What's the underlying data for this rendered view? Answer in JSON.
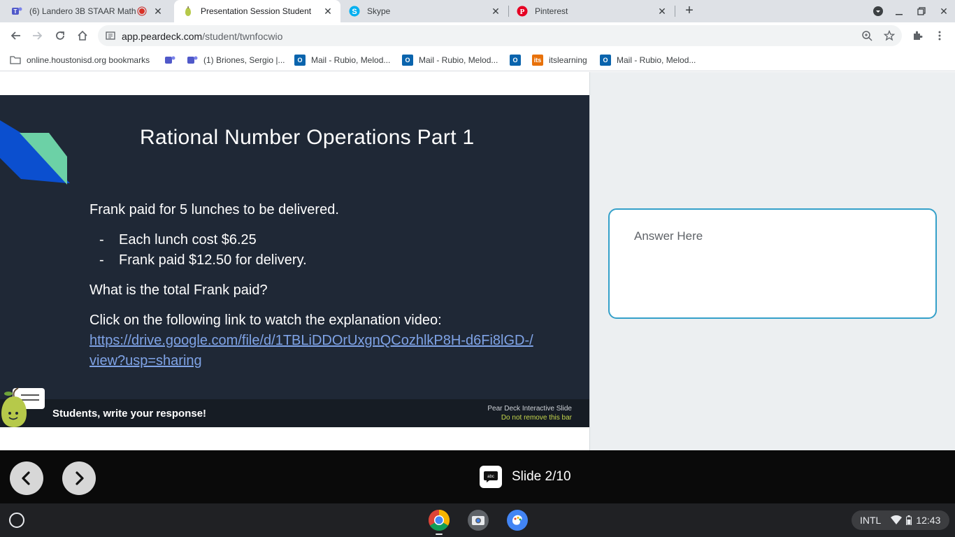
{
  "browser": {
    "tabs": [
      {
        "title": "(6) Landero 3B STAAR Math",
        "icon": "teams-icon",
        "active": false
      },
      {
        "title": "Presentation Session Student",
        "icon": "peardeck-icon",
        "active": true
      },
      {
        "title": "Skype",
        "icon": "skype-icon",
        "active": false
      },
      {
        "title": "Pinterest",
        "icon": "pinterest-icon",
        "active": false
      }
    ],
    "url_host": "app.peardeck.com",
    "url_path": "/student/twnfocwio"
  },
  "bookmarks": [
    {
      "label": "online.houstonisd.org bookmarks",
      "icon": "folder-icon"
    },
    {
      "label": "",
      "icon": "teams-icon"
    },
    {
      "label": "(1) Briones, Sergio |...",
      "icon": "teams-icon"
    },
    {
      "label": "Mail - Rubio, Melod...",
      "icon": "outlook-icon"
    },
    {
      "label": "Mail - Rubio, Melod...",
      "icon": "outlook-icon"
    },
    {
      "label": "",
      "icon": "outlook-icon"
    },
    {
      "label": "itslearning",
      "icon": "itslearning-icon"
    },
    {
      "label": "Mail - Rubio, Melod...",
      "icon": "outlook-icon"
    }
  ],
  "slide": {
    "title": "Rational Number Operations Part 1",
    "intro": "Frank paid for 5 lunches to be delivered.",
    "bullets": [
      "Each lunch cost $6.25",
      "Frank paid $12.50 for delivery."
    ],
    "question": "What is the total Frank paid?",
    "link_prompt": "Click on the following link to watch the explanation video:",
    "link": "https://drive.google.com/file/d/1TBLiDDOrUxgnQCozhlkP8H-d6Fi8lGD-/view?usp=sharing",
    "response_prompt": "Students, write your response!",
    "pd_tag_1": "Pear Deck Interactive Slide",
    "pd_tag_2": "Do not remove this bar"
  },
  "answer": {
    "placeholder": "Answer Here"
  },
  "nav": {
    "slide_counter": "Slide 2/10"
  },
  "shelf": {
    "locale": "INTL",
    "time": "12:43"
  },
  "colors": {
    "accent": "#34a0c9",
    "slide_bg": "#1f2836",
    "link": "#7fa3e6"
  }
}
